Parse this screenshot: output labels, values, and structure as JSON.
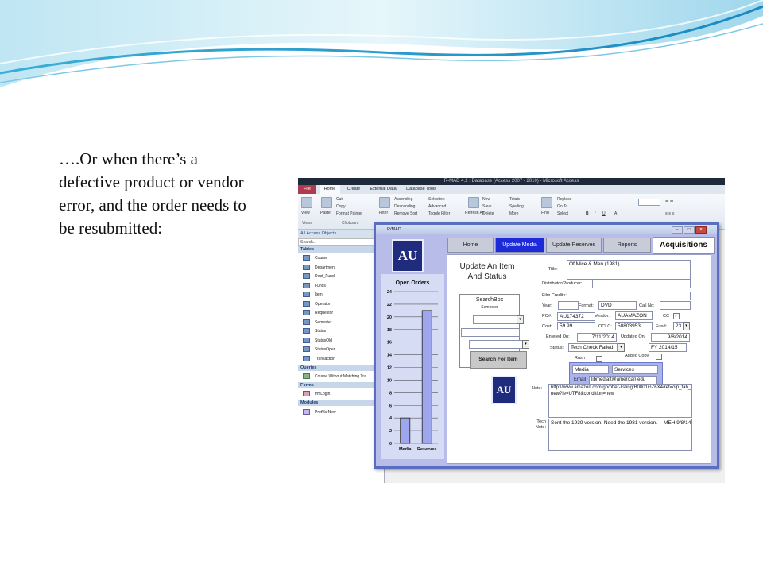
{
  "slide": {
    "text": "….Or when there’s a defective product or vendor error, and the order needs to be resubmitted:"
  },
  "app": {
    "window_title": "R-MAD 4.1 : Database (Access 2007 - 2010) - Microsoft Access",
    "ribbon_tabs": [
      "File",
      "Home",
      "Create",
      "External Data",
      "Database Tools"
    ],
    "ribbon": {
      "view": "View",
      "paste": "Paste",
      "cut": "Cut",
      "copy": "Copy",
      "format_painter": "Format Painter",
      "filter": "Filter",
      "ascending": "Ascending",
      "descending": "Descending",
      "remove_sort": "Remove Sort",
      "selection": "Selection",
      "advanced": "Advanced",
      "toggle_filter": "Toggle Filter",
      "refresh_all": "Refresh All",
      "new": "New",
      "save": "Save",
      "delete": "Delete",
      "totals": "Totals",
      "spelling": "Spelling",
      "more": "More",
      "find": "Find",
      "replace": "Replace",
      "go_to": "Go To",
      "select": "Select",
      "groups": [
        "Views",
        "Clipboard"
      ]
    },
    "nav": {
      "header": "All Access Objects",
      "search_placeholder": "Search...",
      "groups": {
        "tables": "Tables",
        "queries": "Queries",
        "forms": "Forms",
        "modules": "Modules"
      },
      "tables": [
        "Course",
        "Department",
        "Dept_Fund",
        "Funds",
        "Item",
        "Operator",
        "Requestor",
        "Semester",
        "Status",
        "StatusOld",
        "StatusOper",
        "Transaction"
      ],
      "queries": [
        "Course Without Matching Tra"
      ],
      "forms": [
        "frmLogin"
      ],
      "modules": [
        "ProtVarNew"
      ]
    }
  },
  "form": {
    "title": "R/MAD",
    "tabs": [
      "Home",
      "Update Media",
      "Update Reserves",
      "Reports"
    ],
    "active_tab": "Update Media",
    "section_title": "Acquisitions",
    "logo_text": "AU",
    "heading": "Update An Item And Status",
    "searchbox": {
      "title": "SearchBox",
      "semester_label": "Semester",
      "button": "Search For Item"
    },
    "labels": {
      "title": "Title:",
      "distributor": "Distributor/Producer:",
      "film_credits": "Film Credits:",
      "year": "Year:",
      "format": "Format:",
      "call_no": "Call No:",
      "po": "PO#:",
      "vendor": "Vendor:",
      "cc": "CC",
      "cost": "Cost:",
      "oclc": "OCLC:",
      "fund": "Fund:",
      "entered_on": "Entered On:",
      "updated_on": "Updated On:",
      "status": "Status:",
      "rush": "Rush",
      "added_copy": "Added Copy",
      "email": "Email",
      "note": "Note:",
      "tech_note": "Tech Note:"
    },
    "values": {
      "title": "Of Mice & Men (1981)",
      "distributor": "",
      "film_credits": "",
      "year": "",
      "format": "DVD",
      "call_no": "",
      "po": "AU174372",
      "vendor": "AUAMAZON",
      "cc_checked": "✓",
      "cost": "59.99",
      "oclc": "50803953",
      "fund": "23",
      "entered_on": "7/11/2014",
      "updated_on": "9/8/2014",
      "status": "Tech Check Failed",
      "fiscal_year": "FY 2014/15",
      "media": "Media",
      "services": "Services",
      "email": "libmediaft@american.edu",
      "note": "http://www.amazon.com/gp/offer-listing/B0001GZ6X4/ref=olp_tab_new?ie=UTF8&condition=new",
      "tech_note": "Sent the 1939 version. Need the 1981 version. -- MEH 9/8/14"
    }
  },
  "chart_data": {
    "type": "bar",
    "title": "Open Orders",
    "categories": [
      "Media",
      "Reserves"
    ],
    "values": [
      4,
      21
    ],
    "ylim": [
      0,
      24
    ],
    "yticks": [
      0,
      2,
      4,
      6,
      8,
      10,
      12,
      14,
      16,
      18,
      20,
      22,
      24
    ],
    "grid": true,
    "bar_color": "#9ea6ee"
  }
}
